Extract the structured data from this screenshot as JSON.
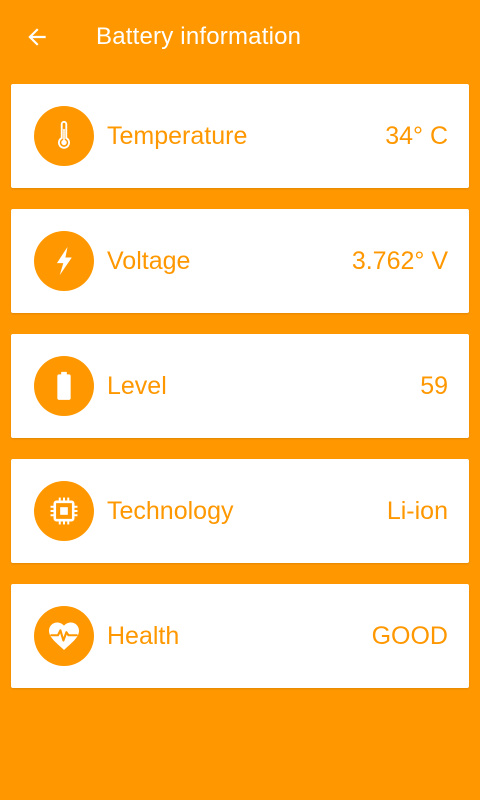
{
  "header": {
    "title": "Battery information",
    "back_icon": "arrow-left-icon"
  },
  "colors": {
    "accent": "#FF9800",
    "card_background": "#FFFFFF"
  },
  "items": [
    {
      "label": "Temperature",
      "value": "34° C",
      "icon": "thermometer-icon"
    },
    {
      "label": "Voltage",
      "value": "3.762° V",
      "icon": "lightning-bolt-icon"
    },
    {
      "label": "Level",
      "value": "59",
      "icon": "battery-icon"
    },
    {
      "label": "Technology",
      "value": "Li-ion",
      "icon": "chip-icon"
    },
    {
      "label": "Health",
      "value": "GOOD",
      "icon": "heart-pulse-icon"
    }
  ]
}
